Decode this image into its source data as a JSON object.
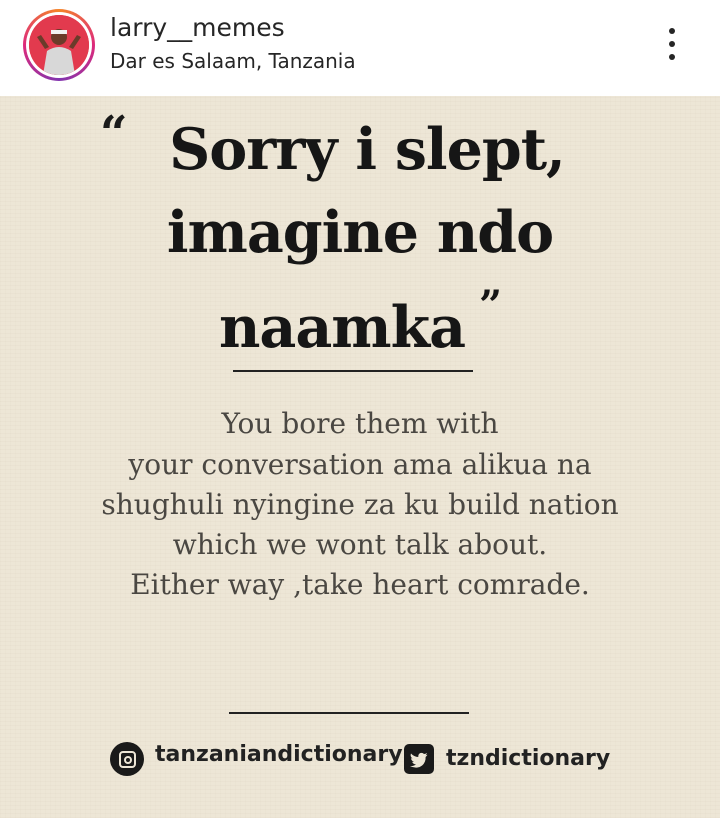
{
  "header": {
    "username": "larry__memes",
    "location": "Dar es Salaam, Tanzania",
    "avatar_icon": "profile-avatar",
    "more_icon": "more-vertical-icon",
    "ring_colors": [
      "#f58529",
      "#dd2a7b",
      "#8134af"
    ]
  },
  "post": {
    "background_color": "#ede6d6",
    "quote_open": "“",
    "quote_lines": [
      "Sorry i slept,",
      "imagine ndo",
      "naamka"
    ],
    "quote_close": "”",
    "body_lines": [
      "You bore them with",
      "your conversation ama alikua na",
      "shughuli nyingine za ku build nation",
      "which we wont talk about.",
      "Either way ,take heart comrade."
    ],
    "instagram_icon": "instagram-icon",
    "instagram_handle": "tanzaniandictionary",
    "twitter_icon": "twitter-icon",
    "twitter_handle": "tzndictionary"
  }
}
